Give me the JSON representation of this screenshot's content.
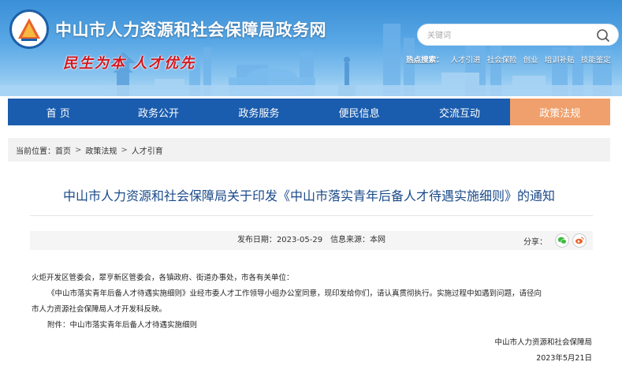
{
  "header": {
    "site_title": "中山市人力资源和社会保障局政务网",
    "slogan": "民生为本 人才优先",
    "search": {
      "placeholder": "关键词"
    },
    "hot_search": {
      "label": "热点搜索：",
      "links": [
        "人才引进",
        "社会保险",
        "创业",
        "培训补贴",
        "技能鉴定"
      ]
    }
  },
  "nav": {
    "items": [
      "首 页",
      "政务公开",
      "政务服务",
      "便民信息",
      "交流互动",
      "政策法规"
    ],
    "active_index": 5
  },
  "breadcrumb": {
    "prefix": "当前位置：",
    "items": [
      "首页",
      "政策法规",
      "人才引育"
    ],
    "separator": ">"
  },
  "article": {
    "title": "中山市人力资源和社会保障局关于印发《中山市落实青年后备人才待遇实施细则》的通知",
    "publish_label": "发布日期：",
    "publish_date": "2023-05-29",
    "source_label": "信息来源：",
    "source": "本网",
    "share_label": "分享：",
    "paragraphs": [
      "火炬开发区管委会，翠亨新区管委会，各镇政府、街道办事处，市各有关单位：",
      "《中山市落实青年后备人才待遇实施细则》业经市委人才工作领导小组办公室同意，现印发给你们，请认真贯彻执行。实施过程中如遇到问题，请径向",
      "市人力资源社会保障局人才开发科反映。",
      "附件：中山市落实青年后备人才待遇实施细则"
    ],
    "signer": "中山市人力资源和社会保障局",
    "sign_date": "2023年5月21日"
  },
  "colors": {
    "nav_bg": "#1a5cad",
    "nav_active": "#f0a06c",
    "title_color": "#1a4a8a",
    "slogan_color": "#d4161c",
    "wechat_green": "#3dbb3d",
    "weibo_orange": "#e8632b"
  }
}
